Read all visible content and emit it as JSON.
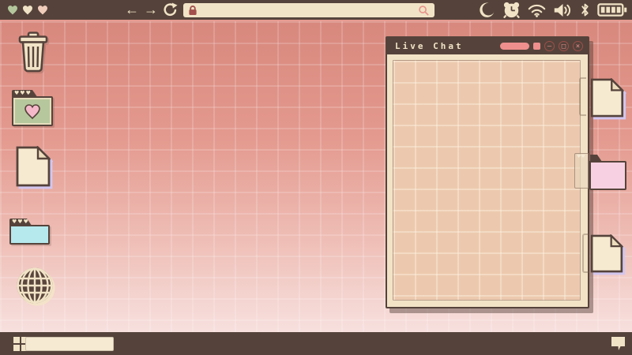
{
  "colors": {
    "bar_brown": "#55433b",
    "cream": "#f1e3c6",
    "salmon_accent": "#e79b91",
    "pink_control": "#ee8f8d",
    "control_ring": "#9e4f4a",
    "lock_red": "#a34f4b",
    "desktop_gradient_top": "#d8887d",
    "desktop_gradient_bottom": "#f7e0de",
    "window_body": "#f2e3c6",
    "window_content": "#ecc9ae",
    "lavender_glow": "#d2c6ef",
    "folder_green": "#b7c79d",
    "folder_cyan": "#b5e9ee",
    "folder_pink": "#f7d0e2",
    "heart_pink": "#f5b8cb"
  },
  "topbar": {
    "hearts": [
      {
        "name": "heart-green",
        "color": "#b4c79c"
      },
      {
        "name": "heart-cream",
        "color": "#f1e3c6"
      },
      {
        "name": "heart-peach",
        "color": "#f0cdbb"
      }
    ],
    "nav": {
      "back": "←",
      "forward": "→"
    },
    "url_bar": {
      "value": "",
      "left_icon": "lock-icon",
      "right_icon": "search-icon"
    },
    "tray_icons": [
      "moon",
      "alarm-clock",
      "wifi",
      "volume",
      "bluetooth",
      "battery"
    ],
    "battery": {
      "bars": 4
    }
  },
  "desktop": {
    "left_icons": [
      "trash",
      "heart-folder",
      "document",
      "cyan-folder",
      "globe"
    ],
    "right_edge_icons": [
      "document",
      "pink-folder",
      "document"
    ]
  },
  "window": {
    "title": "Live Chat",
    "controls": {
      "minimize": "–",
      "maximize": "□",
      "close": "×"
    }
  },
  "taskbar": {
    "start": "start-button",
    "search": {
      "value": ""
    },
    "tray": [
      "chat-bubble"
    ]
  }
}
